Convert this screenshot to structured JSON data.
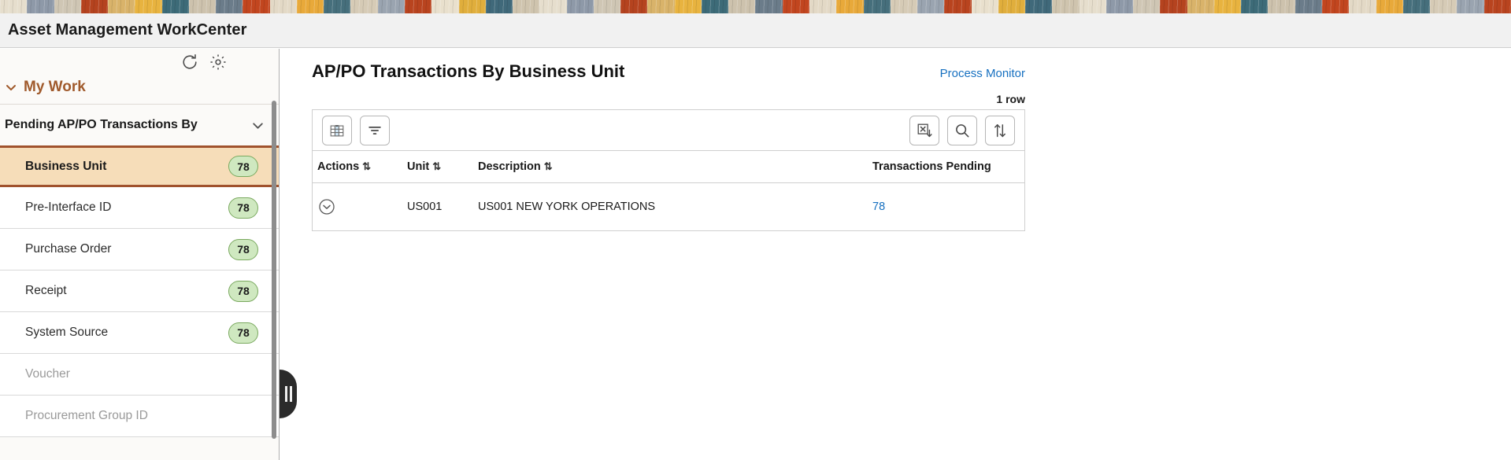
{
  "window": {
    "title": "Asset Management WorkCenter"
  },
  "banner": {
    "name": "decorative-banner",
    "colors": [
      "#e6decd",
      "#8e99a8",
      "#cfc6b4",
      "#b5431f",
      "#d9b36a",
      "#e8b33f",
      "#3d6b78",
      "#cdc2ad",
      "#6b7c8a",
      "#c2461f",
      "#e3d9c6",
      "#e8a93a",
      "#466f7c",
      "#d6cbb6",
      "#9aa4b0",
      "#b9441f",
      "#e9e0cd",
      "#e0ae3c",
      "#40697a",
      "#cfc4ae"
    ]
  },
  "sidebar": {
    "tools": [
      {
        "name": "refresh-icon",
        "label": "Refresh"
      },
      {
        "name": "gear-icon",
        "label": "Settings"
      }
    ],
    "my_work": {
      "label": "My Work",
      "expanded": true
    },
    "group": {
      "label": "Pending AP/PO Transactions By",
      "expanded": true
    },
    "items": [
      {
        "label": "Business Unit",
        "badge": "78",
        "selected": true,
        "disabled": false
      },
      {
        "label": "Pre-Interface ID",
        "badge": "78",
        "selected": false,
        "disabled": false
      },
      {
        "label": "Purchase Order",
        "badge": "78",
        "selected": false,
        "disabled": false
      },
      {
        "label": "Receipt",
        "badge": "78",
        "selected": false,
        "disabled": false
      },
      {
        "label": "System Source",
        "badge": "78",
        "selected": false,
        "disabled": false
      },
      {
        "label": "Voucher",
        "badge": "",
        "selected": false,
        "disabled": true
      },
      {
        "label": "Procurement Group ID",
        "badge": "",
        "selected": false,
        "disabled": true
      }
    ],
    "collapse_handle": {
      "name": "collapse-sidebar-handle"
    }
  },
  "main": {
    "title": "AP/PO Transactions By Business Unit",
    "process_monitor_link": "Process Monitor",
    "row_count": "1 row",
    "toolbar": [
      {
        "name": "personalize-grid-icon",
        "label": "Personalize"
      },
      {
        "name": "filter-icon",
        "label": "Filter"
      },
      {
        "name": "download-excel-icon",
        "label": "Download to Excel"
      },
      {
        "name": "search-icon",
        "label": "Find"
      },
      {
        "name": "sort-icon",
        "label": "Sort"
      }
    ],
    "table": {
      "columns": [
        {
          "label": "Actions",
          "sortable": true
        },
        {
          "label": "Unit",
          "sortable": true
        },
        {
          "label": "Description",
          "sortable": true
        },
        {
          "label": "Transactions Pending",
          "sortable": false
        }
      ],
      "sort_glyph": "⇅",
      "rows": [
        {
          "action_icon": "chevron-down-circle-icon",
          "unit": "US001",
          "description": "US001 NEW YORK OPERATIONS",
          "transactions_pending": "78"
        }
      ]
    }
  },
  "colors": {
    "link": "#1670c0",
    "accent_brown": "#a0522d",
    "selected_bg": "#f6ddb9",
    "badge_bg": "#cfe8c0",
    "title_bar_bg": "#f1f1f1"
  }
}
